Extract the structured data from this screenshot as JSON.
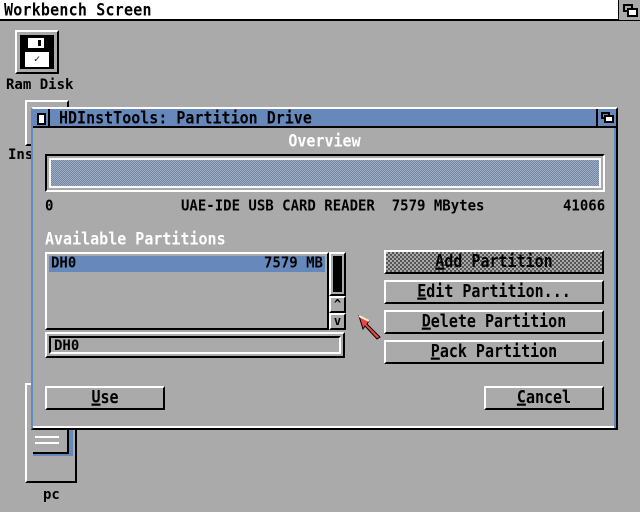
{
  "screen": {
    "title": "Workbench Screen",
    "depth_icon": "depth-gadget-icon"
  },
  "desktop_icons": [
    {
      "label": "Ram Disk",
      "icon": "floppy-disk-icon"
    },
    {
      "label": "Ins",
      "icon": "drawer-icon"
    },
    {
      "label": "pc",
      "icon": "harddisk-icon"
    }
  ],
  "window": {
    "title": "HDInstTools: Partition Drive",
    "overview_label": "Overview",
    "cylinder_start": "0",
    "drive_info": "UAE-IDE USB CARD READER  7579 MBytes",
    "cylinder_end": "41066",
    "available_label": "Available Partitions",
    "partitions": [
      {
        "name": "DH0",
        "size": "7579 MB",
        "selected": true
      }
    ],
    "scroll_up": "^",
    "scroll_down": "v",
    "name_field_value": "DH0",
    "buttons": {
      "add": {
        "hotkey": "A",
        "rest": "dd Partition",
        "disabled": true
      },
      "edit": {
        "hotkey": "E",
        "rest": "dit Partition...",
        "disabled": false
      },
      "delete": {
        "hotkey": "D",
        "rest": "elete Partition",
        "disabled": false
      },
      "pack": {
        "hotkey": "P",
        "rest": "ack Partition",
        "disabled": false
      },
      "use": {
        "hotkey": "U",
        "rest": "se",
        "disabled": false
      },
      "cancel": {
        "hotkey": "C",
        "rest": "ancel",
        "disabled": false
      }
    }
  },
  "colors": {
    "background": "#aaaaaa",
    "accent": "#6688bb",
    "highlight": "#ffffff",
    "shadow": "#000000",
    "pointer": "#ee4444"
  }
}
